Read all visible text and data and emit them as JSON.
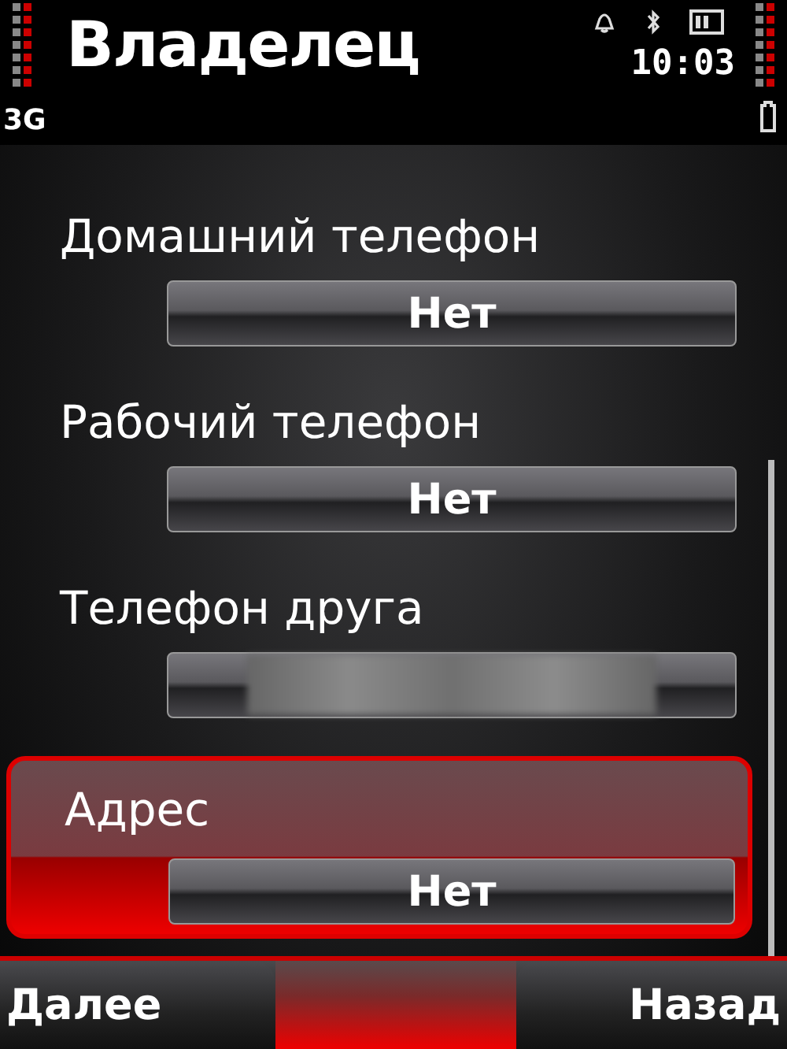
{
  "title": "Владелец",
  "network": "3G",
  "time": "10:03",
  "fields": [
    {
      "label": "Домашний телефон",
      "value": "Нет",
      "blurred": false,
      "selected": false
    },
    {
      "label": "Рабочий телефон",
      "value": "Нет",
      "blurred": false,
      "selected": false
    },
    {
      "label": "Телефон друга",
      "blurred": true,
      "selected": false
    },
    {
      "label": "Адрес",
      "value": "Нет",
      "blurred": false,
      "selected": true
    }
  ],
  "softkeys": {
    "left": "Далее",
    "right": "Назад"
  }
}
